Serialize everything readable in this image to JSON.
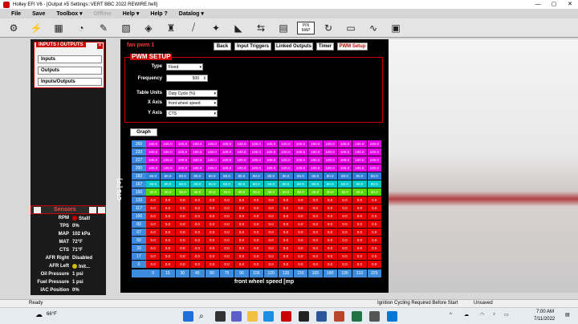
{
  "window": {
    "title": "Holley EFI V6 - [Output #5 Settings::VERT BBC 2022 REWIRE.hefi]",
    "controls": [
      "—",
      "▢",
      "✕"
    ]
  },
  "menu": [
    {
      "label": "File",
      "dim": false
    },
    {
      "label": "Save",
      "dim": false
    },
    {
      "label": "Toolbox ▾",
      "dim": false
    },
    {
      "label": "Offline",
      "dim": true
    },
    {
      "label": "Help ▾",
      "dim": false
    },
    {
      "label": "Help ?",
      "dim": false
    },
    {
      "label": "Datalog ▾",
      "dim": false
    }
  ],
  "toolbar_icons": [
    "engine-icon",
    "bolt-icon",
    "calculator-icon",
    "gauge-icon",
    "wrench-icon",
    "map-icon",
    "sensor-icon",
    "injector-icon",
    "tuning-icon",
    "lamp-icon",
    "flag-icon",
    "wire-icon",
    "graph-icon",
    "laptop-icon",
    "pin-map-icon",
    "refresh-icon",
    "notebook-icon",
    "sweep-icon",
    "monitor-icon"
  ],
  "pin_map_label": "PIN MAP",
  "io": {
    "title": "INPUTS / OUTPUTS",
    "items": [
      "Inputs",
      "Outputs",
      "Inputs/Outputs"
    ]
  },
  "sensors": {
    "title": "Sensors",
    "rows": [
      {
        "label": "RPM",
        "value": "Stall!",
        "dot": "#c00"
      },
      {
        "label": "TPS",
        "value": "0%"
      },
      {
        "label": "MAP",
        "value": "102 kPa"
      },
      {
        "label": "MAT",
        "value": "72°F"
      },
      {
        "label": "CTS",
        "value": "71°F"
      },
      {
        "label": "AFR Right",
        "value": "Disabled"
      },
      {
        "label": "AFR Left",
        "value": "Init...",
        "dot": "#ccc000"
      },
      {
        "label": "Oil Pressure",
        "value": "1 psi"
      },
      {
        "label": "Fuel Pressure",
        "value": "1 psi"
      },
      {
        "label": "IAC Position",
        "value": "0%"
      }
    ]
  },
  "output": {
    "name": "fan pwm 1",
    "tabs": [
      {
        "label": "Back",
        "active": false
      },
      {
        "label": "Input Triggers",
        "active": false
      },
      {
        "label": "Linked Outputs",
        "active": false
      },
      {
        "label": "Timer",
        "active": false
      },
      {
        "label": "PWM Setup",
        "active": true
      }
    ]
  },
  "pwm": {
    "title": "PWM SETUP",
    "type_label": "Type",
    "type_value": "Fixed",
    "freq_label": "Frequency",
    "freq_value": "500",
    "units_label": "Table Units",
    "units_value": "Duty Cycle (%)",
    "xaxis_label": "X Axis",
    "xaxis_value": "front wheel speed",
    "yaxis_label": "Y Axis",
    "yaxis_value": "CTS"
  },
  "graph_button": "Graph",
  "table": {
    "y_axis_title": "CTS [°F]",
    "x_axis_title": "front wheel speed [mp",
    "y_values": [
      "250",
      "233",
      "217",
      "200",
      "183",
      "167",
      "150",
      "133",
      "117",
      "100",
      "83",
      "67",
      "50",
      "33",
      "17",
      "0"
    ],
    "x_values": [
      "0",
      "15",
      "30",
      "45",
      "60",
      "75",
      "90",
      "105",
      "120",
      "135",
      "150",
      "165",
      "180",
      "195",
      "210",
      "225"
    ],
    "row_values": [
      "100.0",
      "100.0",
      "100.0",
      "100.0",
      "80.0",
      "60.0",
      "30.0",
      "0.0",
      "0.0",
      "0.0",
      "0.0",
      "0.0",
      "0.0",
      "0.0",
      "0.0",
      "0.0"
    ],
    "colors": {
      "100.0": "#e800e8",
      "80.0": "#2f7fd8",
      "60.0": "#00c8c8",
      "30.0": "#58d800",
      "0.0": "#e60000"
    }
  },
  "status": {
    "left": "Ready",
    "mid": "Ignition Cycling Required Before Start",
    "right": "Unsaved"
  },
  "taskbar": {
    "weather": "66°F",
    "time": "7:00 AM",
    "date": "7/11/2022"
  }
}
